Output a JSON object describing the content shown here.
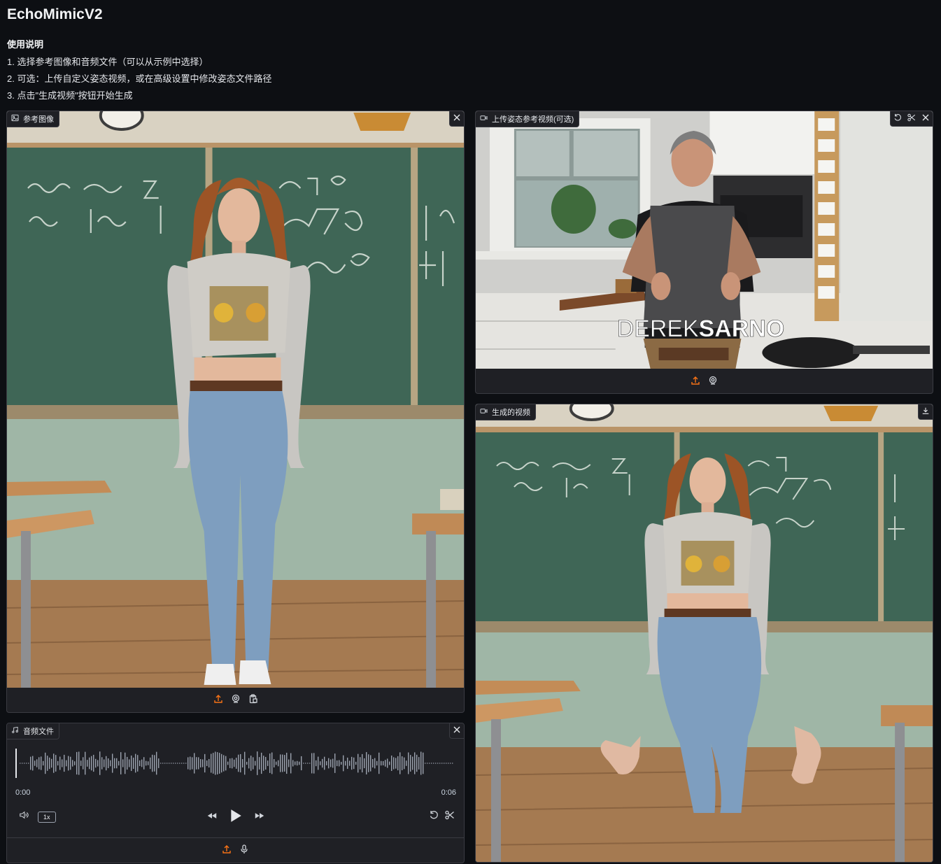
{
  "app": {
    "title": "EchoMimicV2"
  },
  "instructions": {
    "heading": "使用说明",
    "steps": [
      "1. 选择参考图像和音频文件（可以从示例中选择）",
      "2. 可选：上传自定义姿态视频，或在高级设置中修改姿态文件路径",
      "3. 点击\"生成视频\"按钮开始生成"
    ]
  },
  "reference_image": {
    "label": "参考图像",
    "icon": "image-icon"
  },
  "audio": {
    "label": "音频文件",
    "icon": "music-icon",
    "time_start": "0:00",
    "time_end": "0:06",
    "playback_rate": "1x"
  },
  "pose_video": {
    "label": "上传姿态参考视频(可选)",
    "icon": "video-icon",
    "overlay_text_light": "DEREK",
    "overlay_text_bold": "SARNO"
  },
  "output_video": {
    "label": "生成的视频",
    "icon": "video-icon"
  },
  "colors": {
    "accent": "#f97316",
    "background": "#0d0f13",
    "panel": "#1f2025",
    "border": "#3a3b42"
  }
}
